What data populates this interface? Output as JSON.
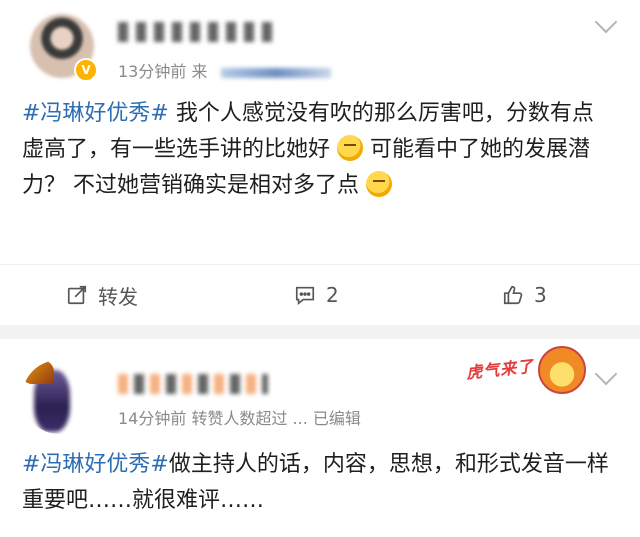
{
  "posts": [
    {
      "meta_time": "13分钟前",
      "meta_source_label": "来",
      "content_tag": "#冯琳好优秀#",
      "content_text_1": " 我个人感觉没有吹的那么厉害吧，分数有点虚高了，有一些选手讲的比她好",
      "content_text_2": "可能看中了她的发展潜力？ 不过她营销确实是相对多了点",
      "actions": {
        "forward_label": "转发",
        "comment_count": "2",
        "like_count": "3"
      }
    },
    {
      "meta_time": "14分钟前",
      "meta_extra": "转赞人数超过 ...",
      "meta_edited": "已编辑",
      "badge_text": "虎气来了",
      "content_tag": "#冯琳好优秀#",
      "content_text": "做主持人的话，内容，思想，和形式发音一样重要吧……就很难评……"
    }
  ],
  "icons": {
    "verified": "verified-v-icon",
    "chevron": "chevron-down-icon",
    "forward": "forward-edit-icon",
    "comment": "comment-bubble-icon",
    "like": "thumbs-up-icon",
    "emoji1": "thinking-face-emoji",
    "emoji2": "smirk-face-emoji"
  },
  "colors": {
    "tag": "#2d6db4",
    "meta": "#8a8a8a",
    "divider": "#f2f2f2",
    "verified": "#ffb300"
  }
}
